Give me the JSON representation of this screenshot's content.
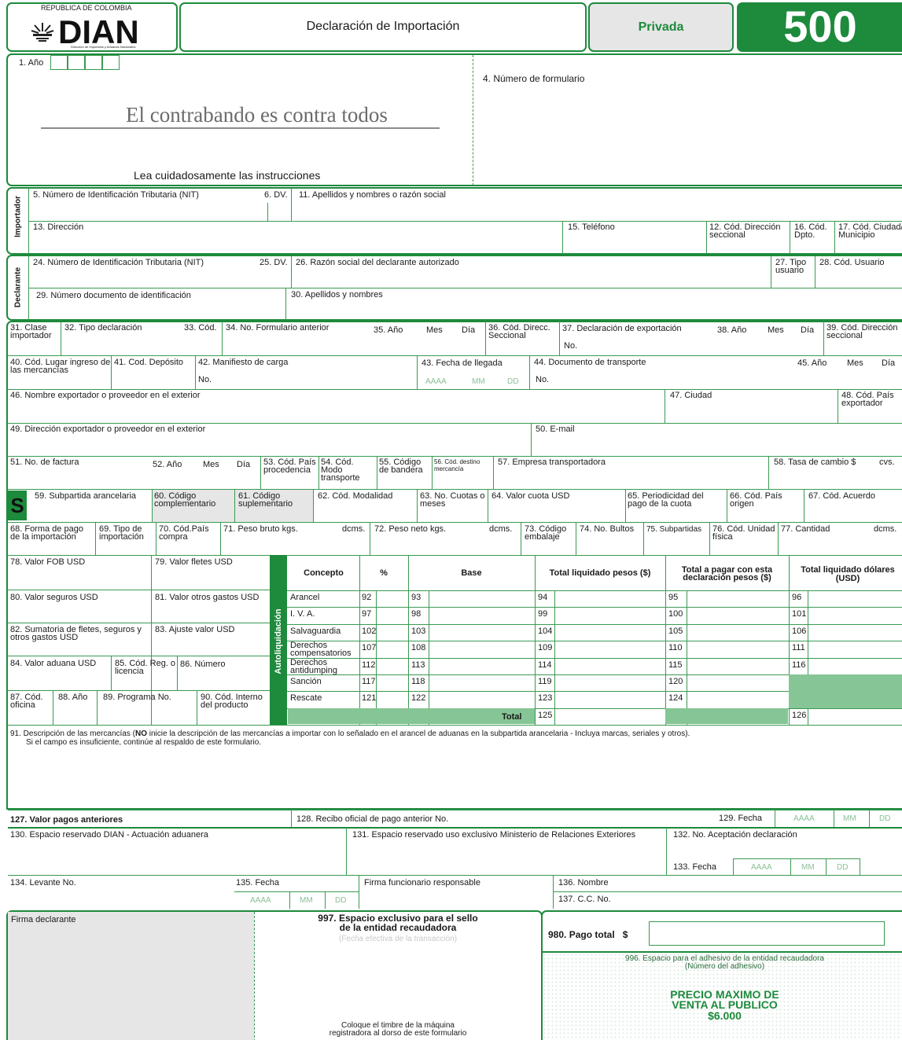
{
  "header": {
    "republic": "REPUBLICA DE COLOMBIA",
    "dian": "DIAN",
    "dian_sub": "Dirección de Impuestos y Aduanas Nacionales",
    "title": "Declaración de Importación",
    "privada": "Privada",
    "form_number": "500"
  },
  "top": {
    "f1": "1. Año",
    "f4": "4. Número de formulario",
    "slogan": "El contrabando es contra todos",
    "instructions": "Lea cuidadosamente las instrucciones"
  },
  "importador": {
    "side": "Importador",
    "f5": "5. Número de Identificación Tributaria (NIT)",
    "f6": "6. DV.",
    "f11": "11. Apellidos y nombres o razón social",
    "f13": "13. Dirección",
    "f15": "15. Teléfono",
    "f12": "12. Cód. Dirección seccional",
    "f16": "16. Cód. Dpto.",
    "f17": "17. Cód. Ciudad/ Municipio"
  },
  "declarante": {
    "side": "Declarante",
    "f24": "24. Número de Identificación Tributaria (NIT)",
    "f25": "25. DV.",
    "f26": "26. Razón social del declarante autorizado",
    "f27": "27. Tipo usuario",
    "f28": "28. Cód. Usuario",
    "f29": "29. Número documento de identificación",
    "f30": "30. Apellidos y nombres"
  },
  "row31": {
    "f31": "31. Clase importador",
    "f32": "32. Tipo declaración",
    "f33": "33. Cód.",
    "f34": "34. No. Formulario anterior",
    "f35": "35. Año",
    "mes": "Mes",
    "dia": "Día",
    "f36": "36. Cód. Direcc. Seccional",
    "f37": "37. Declaración de exportación",
    "no": "No.",
    "f38": "38. Año",
    "mes2": "Mes",
    "dia2": "Día",
    "f39": "39. Cód. Dirección seccional"
  },
  "row40": {
    "f40": "40. Cód. Lugar ingreso de las mercancías",
    "f41": "41. Cod. Depósito",
    "f42": "42. Manifiesto de carga",
    "no": "No.",
    "f43": "43. Fecha de llegada",
    "aaaa": "AAAA",
    "mm": "MM",
    "dd": "DD",
    "f44": "44. Documento de transporte",
    "no2": "No.",
    "f45": "45. Año",
    "mes": "Mes",
    "dia": "Día"
  },
  "row46": {
    "f46": "46. Nombre exportador o proveedor en el exterior",
    "f47": "47. Ciudad",
    "f48": "48. Cód. País exportador",
    "f49": "49. Dirección exportador o proveedor en el exterior",
    "f50": "50. E-mail"
  },
  "row51": {
    "f51": "51. No. de factura",
    "f52": "52. Año",
    "mes": "Mes",
    "dia": "Día",
    "f53": "53. Cód. País procedencia",
    "f54": "54. Cód. Modo transporte",
    "f55": "55. Código de bandera",
    "f56": "56. Cód. destino mercancía",
    "f57": "57. Empresa transportadora",
    "f58": "58. Tasa de cambio $",
    "cvs": "cvs."
  },
  "row59": {
    "s": "S",
    "f59": "59. Subpartida arancelaria",
    "f60": "60. Código complementario",
    "f61": "61. Código suplementario",
    "f62": "62. Cód. Modalidad",
    "f63": "63. No. Cuotas o meses",
    "f64": "64. Valor cuota USD",
    "f65": "65. Periodicidad del pago de la cuota",
    "f66": "66. Cód. País origen",
    "f67": "67. Cód. Acuerdo"
  },
  "row68": {
    "f68": "68. Forma de pago de la importación",
    "f69": "69. Tipo de importación",
    "f70": "70. Cód.País compra",
    "f71": "71. Peso bruto kgs.",
    "dcms1": "dcms.",
    "f72": "72. Peso neto kgs.",
    "dcms2": "dcms.",
    "f73": "73. Código embalaje",
    "f74": "74. No. Bultos",
    "f75": "75. Subpartidas",
    "f76": "76. Cód. Unidad física",
    "f77": "77. Cantidad",
    "dcms3": "dcms."
  },
  "valores": {
    "f78": "78. Valor FOB USD",
    "f79": "79. Valor fletes USD",
    "f80": "80. Valor seguros  USD",
    "f81": "81. Valor otros gastos USD",
    "f82": "82. Sumatoria de fletes, seguros y otros gastos USD",
    "f83": "83. Ajuste valor  USD",
    "f84": "84. Valor aduana USD",
    "f85": "85. Cód. Reg. o licencia",
    "f86": "86. Número",
    "f87": "87. Cód. oficina",
    "f88": "88. Año",
    "f89": "89. Programa No.",
    "f90": "90. Cód. Interno del producto"
  },
  "autoliq": {
    "side": "Autoliquidación",
    "h_concepto": "Concepto",
    "h_pct": "%",
    "h_base": "Base",
    "h_total_pesos": "Total liquidado pesos ($)",
    "h_pagar": "Total a pagar con esta declaración pesos ($)",
    "h_dolares": "Total liquidado dólares (USD)",
    "rows": [
      {
        "c": "Arancel",
        "p": "92",
        "b": "93",
        "t": "94",
        "a": "95",
        "u": "96"
      },
      {
        "c": "I. V. A.",
        "p": "97",
        "b": "98",
        "t": "99",
        "a": "100",
        "u": "101"
      },
      {
        "c": "Salvaguardia",
        "p": "102",
        "b": "103",
        "t": "104",
        "a": "105",
        "u": "106"
      },
      {
        "c": "Derechos compensatorios",
        "p": "107",
        "b": "108",
        "t": "109",
        "a": "110",
        "u": "111"
      },
      {
        "c": "Derechos antidumping",
        "p": "112",
        "b": "113",
        "t": "114",
        "a": "115",
        "u": "116"
      },
      {
        "c": "Sanción",
        "p": "117",
        "b": "118",
        "t": "119",
        "a": "120",
        "u": ""
      },
      {
        "c": "Rescate",
        "p": "121",
        "b": "122",
        "t": "123",
        "a": "124",
        "u": ""
      }
    ],
    "total_label": "Total",
    "total_num": "125",
    "total_usd": "126"
  },
  "f91": {
    "pre": "91. Descripción de las mercancías (",
    "no": "NO",
    "post": " inicie la descripción de las mercancías a importar con lo señalado en el arancel de aduanas en la subpartida arancelaria - Incluya marcas, seriales y otros).",
    "line2": "Si el campo es insuficiente, continúe al respaldo de este formulario."
  },
  "bottom": {
    "f127": "127. Valor pagos anteriores",
    "f128": "128. Recibo oficial de pago anterior No.",
    "f129": "129. Fecha",
    "aaaa": "AAAA",
    "mm": "MM",
    "dd": "DD",
    "f130": "130. Espacio reservado DIAN - Actuación aduanera",
    "f131": "131. Espacio reservado uso exclusivo Ministerio de Relaciones Exteriores",
    "f132": "132. No. Aceptación declaración",
    "f133": "133. Fecha",
    "f134": "134. Levante No.",
    "f135": "135.  Fecha",
    "firma_func": "Firma funcionario responsable",
    "f136": "136. Nombre",
    "f137": "137. C.C. No.",
    "firma_decl": "Firma declarante",
    "f997a": "997. Espacio exclusivo para el sello",
    "f997b": "de la entidad recaudadora",
    "f997c": "(Fecha efectiva de la transacción)",
    "coloque1": "Coloque el timbre de la máquina",
    "coloque2": "registradora al dorso de este formulario",
    "f980": "980. Pago total",
    "dollar": "$",
    "f996a": "996. Espacio para el adhesivo de la entidad recaudadora",
    "f996b": "(Número del adhesivo)",
    "precio1": "PRECIO MAXIMO DE",
    "precio2": "VENTA AL PUBLICO",
    "precio3": "$6.000"
  }
}
